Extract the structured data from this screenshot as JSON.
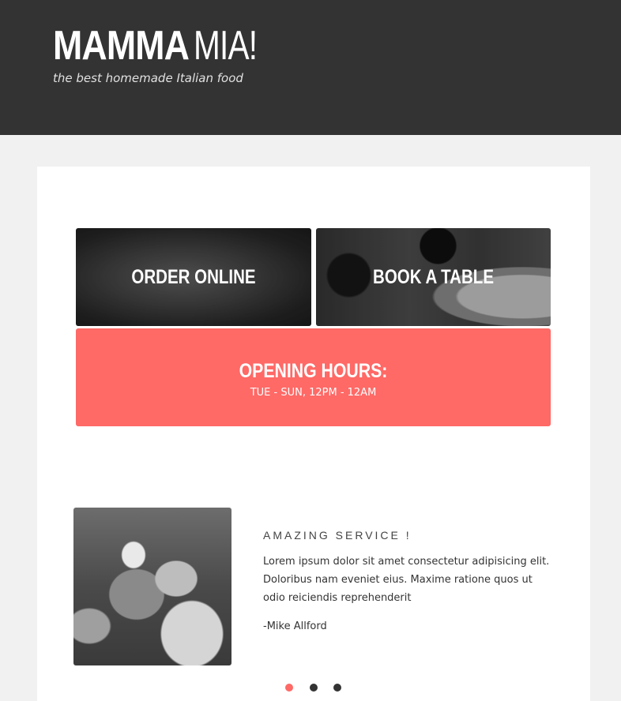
{
  "header": {
    "logo_bold": "MAMMA",
    "logo_light": "MIA!",
    "tagline": "the best homemade Italian food"
  },
  "tiles": {
    "order_label": "ORDER ONLINE",
    "book_label": "BOOK A TABLE"
  },
  "hours": {
    "title": "OPENING HOURS:",
    "time": "TUE - SUN, 12PM - 12AM"
  },
  "review": {
    "title": "AMAZING SERVICE !",
    "text": "Lorem ipsum dolor sit amet consectetur adipisicing elit. Doloribus nam eveniet eius. Maxime ratione quos ut odio reiciendis reprehenderit",
    "author": "-Mike Allford"
  },
  "carousel": {
    "active_index": 0,
    "count": 3
  },
  "colors": {
    "header_bg": "#333333",
    "accent": "#ff6966",
    "page_bg": "#f1f1f1"
  }
}
